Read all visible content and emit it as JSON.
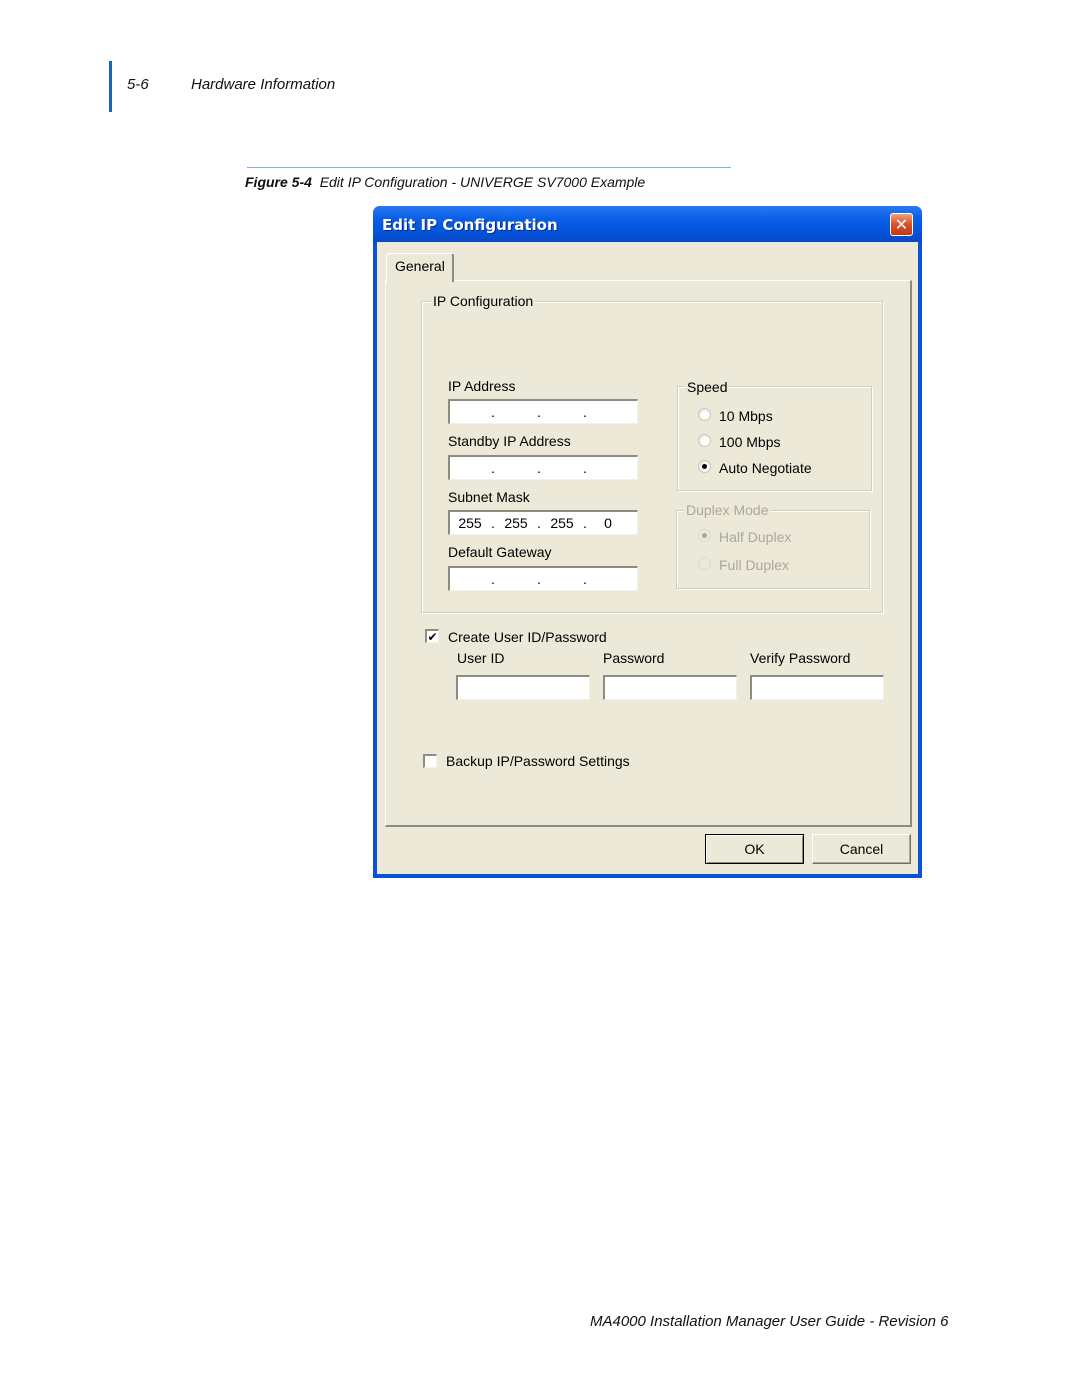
{
  "page_header": {
    "page_number": "5-6",
    "section_title": "Hardware Information"
  },
  "figure": {
    "label": "Figure 5-4",
    "caption": "Edit IP Configuration - UNIVERGE SV7000 Example"
  },
  "dialog": {
    "title": "Edit IP Configuration",
    "close_icon": "close-x-icon",
    "tabs": [
      {
        "label": "General",
        "selected": true
      }
    ],
    "ip_configuration": {
      "legend": "IP Configuration",
      "fields": [
        {
          "label": "IP Address",
          "octets": [
            "",
            "",
            "",
            ""
          ]
        },
        {
          "label": "Standby IP Address",
          "octets": [
            "",
            "",
            "",
            ""
          ]
        },
        {
          "label": "Subnet Mask",
          "octets": [
            "255",
            "255",
            "255",
            "0"
          ]
        },
        {
          "label": "Default Gateway",
          "octets": [
            "",
            "",
            "",
            ""
          ]
        }
      ],
      "separator": ".",
      "speed": {
        "legend": "Speed",
        "options": [
          {
            "label": "10 Mbps",
            "selected": false
          },
          {
            "label": "100 Mbps",
            "selected": false
          },
          {
            "label": "Auto Negotiate",
            "selected": true
          }
        ]
      },
      "duplex": {
        "legend": "Duplex Mode",
        "enabled": false,
        "options": [
          {
            "label": "Half Duplex",
            "selected": true
          },
          {
            "label": "Full Duplex",
            "selected": false
          }
        ]
      }
    },
    "credentials": {
      "checkbox_label": "Create User ID/Password",
      "checked": true,
      "check_glyph": "✔",
      "fields": [
        {
          "label": "User ID",
          "value": ""
        },
        {
          "label": "Password",
          "value": ""
        },
        {
          "label": "Verify Password",
          "value": ""
        }
      ]
    },
    "backup": {
      "checkbox_label": "Backup IP/Password Settings",
      "checked": false
    },
    "buttons": {
      "ok": "OK",
      "cancel": "Cancel"
    }
  },
  "page_footer": {
    "text": "MA4000 Installation Manager User Guide - Revision 6"
  }
}
